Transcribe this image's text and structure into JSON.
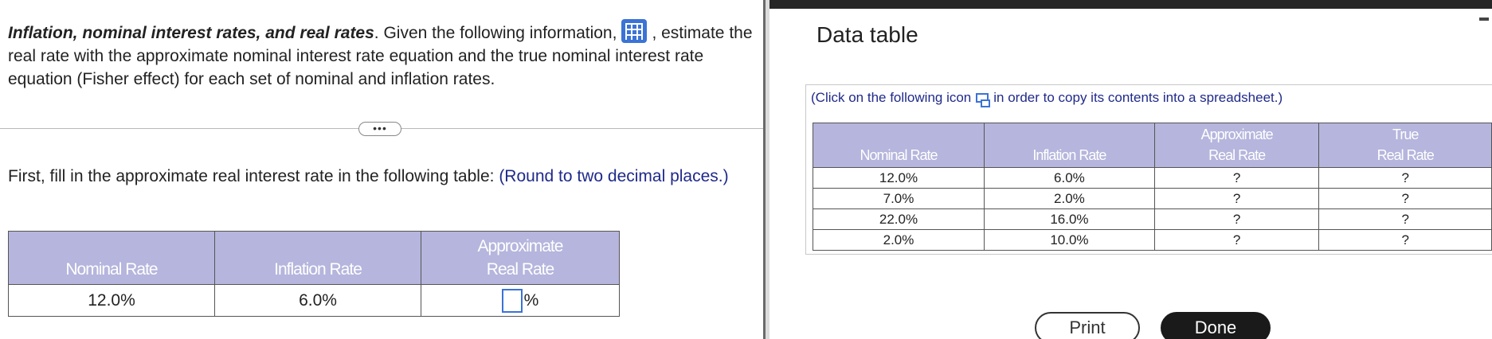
{
  "question": {
    "title_bold": "Inflation, nominal interest rates, and real rates",
    "intro_after_title": ".  Given the following information,",
    "intro_after_icon": ", estimate the real rate with the approximate nominal interest rate equation and the true nominal interest rate equation (Fisher effect) for each set of nominal and inflation rates.",
    "data_icon": "table-grid-icon",
    "more_label": "•••",
    "instruction": "First, fill in the approximate real interest rate in the following table:",
    "instruction_hint": "(Round to two decimal places.)",
    "table": {
      "headers": [
        "Nominal Rate",
        "Inflation Rate",
        "Approximate",
        "Real Rate"
      ],
      "row": {
        "nominal": "12.0%",
        "inflation": "6.0%",
        "answer_value": "",
        "answer_unit": "%"
      }
    }
  },
  "data_table": {
    "title": "Data table",
    "copy_note_before": "(Click on the following icon",
    "copy_note_after": "in order to copy its contents into a spreadsheet.)",
    "copy_icon": "copy-icon",
    "headers": {
      "nominal": "Nominal Rate",
      "inflation": "Inflation Rate",
      "approx_1": "Approximate",
      "approx_2": "Real Rate",
      "true_1": "True",
      "true_2": "Real Rate"
    },
    "rows": [
      {
        "nominal": "12.0%",
        "inflation": "6.0%",
        "approx": "?",
        "true": "?"
      },
      {
        "nominal": "7.0%",
        "inflation": "2.0%",
        "approx": "?",
        "true": "?"
      },
      {
        "nominal": "22.0%",
        "inflation": "16.0%",
        "approx": "?",
        "true": "?"
      },
      {
        "nominal": "2.0%",
        "inflation": "10.0%",
        "approx": "?",
        "true": "?"
      }
    ],
    "print_label": "Print",
    "done_label": "Done"
  },
  "colors": {
    "header_fill": "#b5b5dd",
    "link_blue": "#1f2a8a",
    "icon_blue": "#3b73d6",
    "done_bg": "#1a1a1a"
  }
}
